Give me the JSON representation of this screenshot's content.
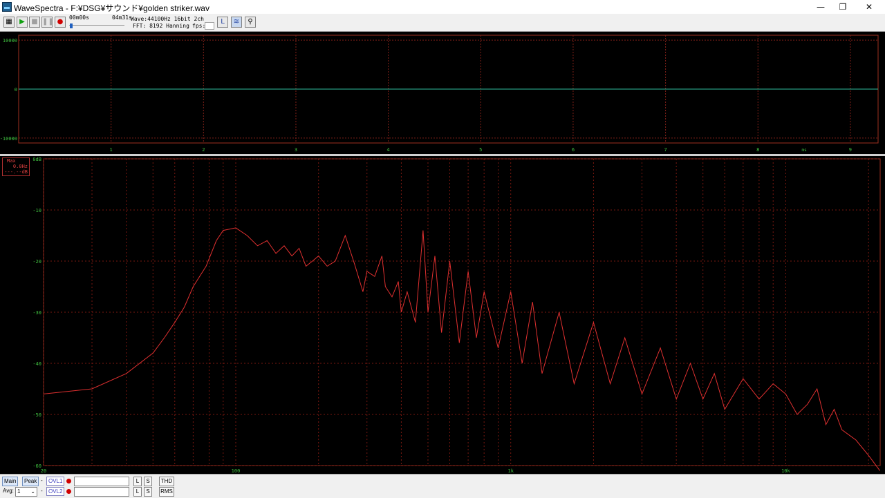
{
  "window": {
    "title": "WaveSpectra - F:¥DSG¥サウンド¥golden striker.wav",
    "minimize_icon": "minimize-icon",
    "maximize_icon": "restore-icon",
    "close_icon": "close-icon"
  },
  "toolbar": {
    "position_time": "00m00s",
    "total_time": "04m31s",
    "wave_info": "Wave:44100Hz 16bit 2ch",
    "fft_info": "FFT: 8192 Hanning",
    "fps_label": "fps:",
    "fps_value": ""
  },
  "wave_axis": {
    "y_labels": [
      "10000",
      "0",
      "-10000"
    ],
    "x_labels": [
      "1",
      "2",
      "3",
      "4",
      "5",
      "6",
      "7",
      "8",
      "9"
    ],
    "x_unit": "ms"
  },
  "spectrum": {
    "readout_title": "Max",
    "readout_freq": "0.0Hz",
    "readout_db": "---.--dB",
    "y_labels": [
      "0dB",
      "-10",
      "-20",
      "-30",
      "-40",
      "-50",
      "-60"
    ],
    "x_labels": [
      "20",
      "100",
      "1k",
      "10k"
    ]
  },
  "chart_data": [
    {
      "type": "line",
      "title": "",
      "xlabel": "ms",
      "ylabel": "",
      "xlim": [
        0,
        9.3
      ],
      "ylim": [
        -11000,
        11000
      ],
      "x": [
        0,
        9.3
      ],
      "series": [
        {
          "values": [
            0,
            0
          ]
        }
      ],
      "grid": true,
      "colors": [
        "#30c0a0"
      ]
    },
    {
      "type": "line",
      "title": "",
      "xlabel": "",
      "ylabel": "",
      "x_scale": "log",
      "xlim": [
        20,
        22050
      ],
      "ylim": [
        -60,
        0
      ],
      "x": [
        20,
        30,
        40,
        50,
        55,
        60,
        65,
        70,
        78,
        85,
        90,
        100,
        110,
        120,
        130,
        140,
        150,
        160,
        170,
        180,
        190,
        200,
        215,
        230,
        250,
        270,
        290,
        300,
        320,
        340,
        350,
        370,
        390,
        400,
        420,
        450,
        480,
        500,
        530,
        560,
        600,
        650,
        700,
        750,
        800,
        900,
        1000,
        1100,
        1200,
        1300,
        1500,
        1700,
        2000,
        2300,
        2600,
        3000,
        3500,
        4000,
        4500,
        5000,
        5500,
        6000,
        7000,
        8000,
        9000,
        10000,
        11000,
        12000,
        13000,
        14000,
        15000,
        16000,
        18000,
        20000,
        22000
      ],
      "series": [
        {
          "values": [
            -46,
            -45,
            -42,
            -38,
            -35,
            -32,
            -29,
            -25,
            -21,
            -16,
            -14,
            -13.5,
            -15,
            -17,
            -16,
            -18.5,
            -17,
            -19,
            -17.5,
            -21,
            -20,
            -19,
            -21,
            -20,
            -15,
            -20.5,
            -26,
            -22,
            -23,
            -19,
            -25,
            -27,
            -24,
            -30,
            -26,
            -32,
            -14,
            -30,
            -19,
            -34,
            -20,
            -36,
            -22,
            -35,
            -26,
            -37,
            -26,
            -40,
            -28,
            -42,
            -30,
            -44,
            -32,
            -44,
            -35,
            -46,
            -37,
            -47,
            -40,
            -47,
            -42,
            -49,
            -43,
            -47,
            -44,
            -46,
            -50,
            -48,
            -45,
            -52,
            -49,
            -53,
            -55,
            -58,
            -61
          ]
        }
      ],
      "grid": true,
      "colors": [
        "#e03030"
      ]
    }
  ],
  "statusbar": {
    "main_label": "Main",
    "peak_label": "Peak",
    "avg_label": "Avg:",
    "avg_value": "1",
    "ovl1_label": "OVL1",
    "ovl2_label": "OVL2",
    "l_label": "L",
    "s_label": "S",
    "thd_label": "THD",
    "rms_label": "RMS",
    "dash": "-"
  }
}
